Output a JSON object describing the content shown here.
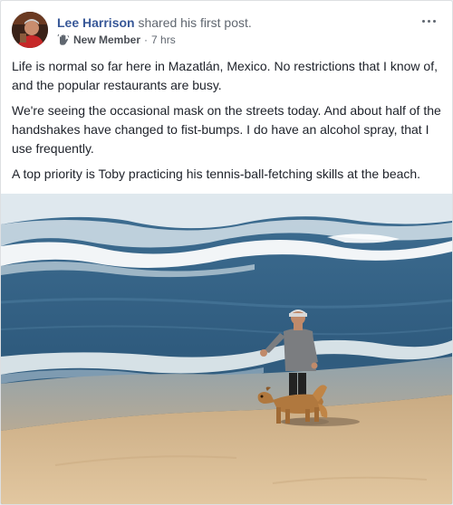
{
  "post": {
    "author": "Lee Harrison",
    "action": "shared his first post.",
    "badge": {
      "icon": "wave-hand-icon",
      "label": "New Member"
    },
    "separator": "·",
    "time": "7 hrs",
    "paragraphs": [
      "Life is normal so far here in Mazatlán, Mexico. No restrictions that I know of, and the popular restaurants are busy.",
      "We're seeing the occasional mask on the streets today. And about half of the handshakes have changed to fist-bumps. I do have an alcohol spray, that I use frequently.",
      "A top priority is Toby practicing his tennis-ball-fetching skills at the beach."
    ]
  },
  "colors": {
    "link": "#385898",
    "meta": "#606770",
    "text": "#1d2129",
    "sea": "#2f5b7e",
    "sand": "#d9bc94"
  }
}
